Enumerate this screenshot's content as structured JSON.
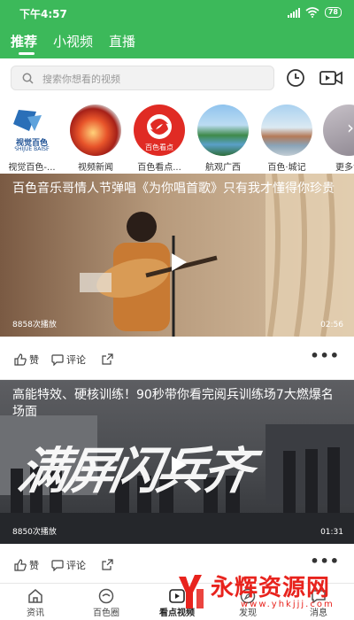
{
  "status": {
    "time": "下午4:57",
    "battery": "78"
  },
  "tabs": [
    {
      "label": "推荐",
      "active": true
    },
    {
      "label": "小视频",
      "active": false
    },
    {
      "label": "直播",
      "active": false
    }
  ],
  "search": {
    "placeholder": "搜索你想看的视频"
  },
  "channels": [
    {
      "label": "视觉百色-...",
      "logo_text": "视觉百色",
      "logo_sub": "SHIJUE BAISE"
    },
    {
      "label": "视频新闻"
    },
    {
      "label": "百色看点...",
      "logo_text": "百色看点"
    },
    {
      "label": "航观广西"
    },
    {
      "label": "百色·城记"
    },
    {
      "label": "更多专"
    }
  ],
  "videos": [
    {
      "title": "百色音乐哥情人节弹唱《为你唱首歌》只有我才懂得你珍贵",
      "plays": "8858次播放",
      "duration": "02:56",
      "like_label": "赞",
      "comment_label": "评论"
    },
    {
      "title": "高能特效、硬核训练！90秒带你看完阅兵训练场7大燃爆名场面",
      "plays": "8850次播放",
      "duration": "01:31",
      "overlay_text": "满屏闪兵齐",
      "like_label": "赞",
      "comment_label": "评论"
    }
  ],
  "bottom_nav": [
    {
      "label": "资讯",
      "icon": "home-icon"
    },
    {
      "label": "百色圈",
      "icon": "circle-icon"
    },
    {
      "label": "看点视频",
      "icon": "play-icon",
      "active": true
    },
    {
      "label": "发现",
      "icon": "discover-icon"
    },
    {
      "label": "消息",
      "icon": "message-icon"
    }
  ],
  "watermark": {
    "brand": "永辉资源网",
    "url": "www.yhkjjj.com"
  },
  "colors": {
    "header_green": "#3cb95a",
    "watermark_red": "#e8231d"
  }
}
